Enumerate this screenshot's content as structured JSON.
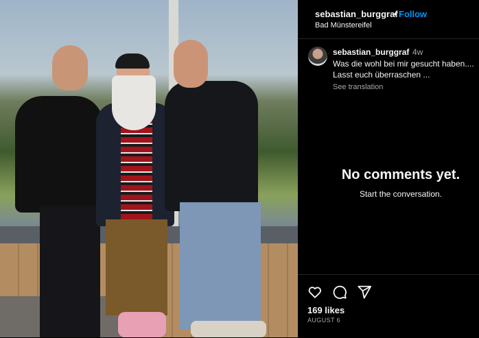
{
  "post": {
    "image_alt": "Three men standing together indoors in front of a large window"
  },
  "header": {
    "username": "sebastian_burggraf",
    "separator": "•",
    "follow_label": "Follow",
    "location": "Bad Münstereifel"
  },
  "caption": {
    "username": "sebastian_burggraf",
    "time_ago": "4w",
    "line1": "Was die wohl bei mir gesucht haben....",
    "line2": "Lasst euch überraschen ...",
    "see_translation": "See translation"
  },
  "comments": {
    "empty_title": "No comments yet.",
    "empty_subtitle": "Start the conversation."
  },
  "actions": {
    "likes": "169 likes",
    "date": "AUGUST 6",
    "icons": [
      "heart-icon",
      "comment-icon",
      "share-icon"
    ]
  },
  "colors": {
    "background": "#000000",
    "link_blue": "#0095f6",
    "muted_text": "#a8a8a8",
    "divider": "#262626"
  }
}
